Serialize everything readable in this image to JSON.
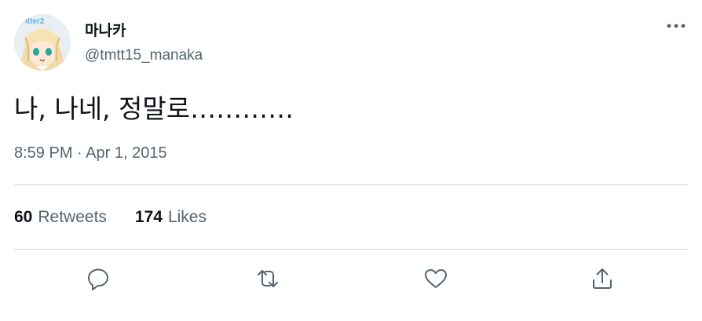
{
  "user": {
    "display_name": "마나카",
    "handle": "@tmtt15_manaka",
    "avatar_icon": "avatar-icon"
  },
  "tweet": {
    "text": "나, 나네, 정말로…………",
    "timestamp": "8:59 PM · Apr 1, 2015"
  },
  "stats": {
    "retweets_count": "60",
    "retweets_label": "Retweets",
    "likes_count": "174",
    "likes_label": "Likes"
  },
  "actions": {
    "reply_icon": "reply-icon",
    "retweet_icon": "retweet-icon",
    "like_icon": "heart-icon",
    "share_icon": "share-icon",
    "more_icon": "more-icon"
  },
  "colors": {
    "text_primary": "#0f1419",
    "text_secondary": "#536471",
    "divider": "#cfd9de",
    "avatar_text": "#5ab4e6"
  }
}
